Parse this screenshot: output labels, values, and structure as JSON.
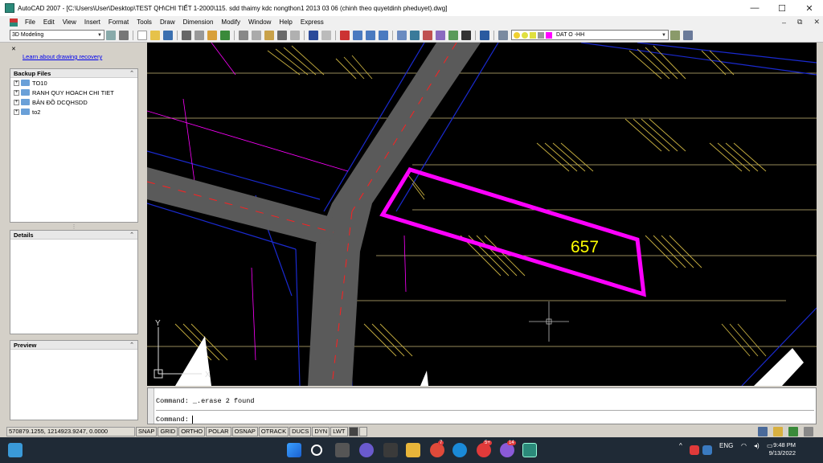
{
  "window": {
    "title": "AutoCAD 2007 - [C:\\Users\\User\\Desktop\\TEST QH\\CHI TIẾT 1-2000\\115. sdd thaimy kdc nongthon1 2013 03 06 (chinh theo quyetdinh pheduyet).dwg]",
    "controls": [
      "—",
      "☐",
      "✕"
    ]
  },
  "menu": [
    "File",
    "Edit",
    "View",
    "Insert",
    "Format",
    "Tools",
    "Draw",
    "Dimension",
    "Modify",
    "Window",
    "Help",
    "Express"
  ],
  "mdi_controls": [
    "–",
    "⧉",
    "✕"
  ],
  "toolbar": {
    "workspace": "3D Modeling",
    "layer": "DAT O -HH"
  },
  "recovery": {
    "link": "Learn about drawing recovery",
    "backup_header": "Backup Files",
    "backup_items": [
      "TO10",
      "RANH QUY HOACH CHI TIET",
      "BẢN ĐỒ DCQHSDD",
      "to2"
    ],
    "details_header": "Details",
    "preview_header": "Preview"
  },
  "drawing": {
    "parcel_label": "657",
    "ucs_y": "Y",
    "ucs_x": "X",
    "colors": {
      "parcel": "#ff00ff",
      "label": "#ffff00",
      "road": "#5a5a5a",
      "hatch": "#c8b040"
    }
  },
  "command": {
    "line1": "Command:  _.erase 2 found",
    "line2": "Command:"
  },
  "status": {
    "coords": "570879.1255, 1214923.9247, 0.0000",
    "buttons": [
      "SNAP",
      "GRID",
      "ORTHO",
      "POLAR",
      "OSNAP",
      "OTRACK",
      "DUCS",
      "DYN",
      "LWT"
    ]
  },
  "taskbar": {
    "lang": "ENG",
    "time": "9:48 PM",
    "date": "9/13/2022",
    "badges": [
      "7",
      "5+",
      "14"
    ]
  }
}
